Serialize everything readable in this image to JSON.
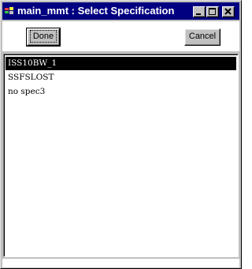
{
  "window": {
    "title": "main_mmt : Select Specification",
    "controls": [
      "minimize-icon",
      "maximize-icon",
      "close-icon"
    ]
  },
  "toolbar": {
    "done_label": "Done",
    "cancel_label": "Cancel"
  },
  "list": {
    "items": [
      "ISS10BW_1",
      "SSFSLOST",
      "no spec3"
    ],
    "selected_index": 0
  },
  "colors": {
    "titlebar": "#000080",
    "face": "#c0c0c0",
    "selection": "#000000"
  }
}
